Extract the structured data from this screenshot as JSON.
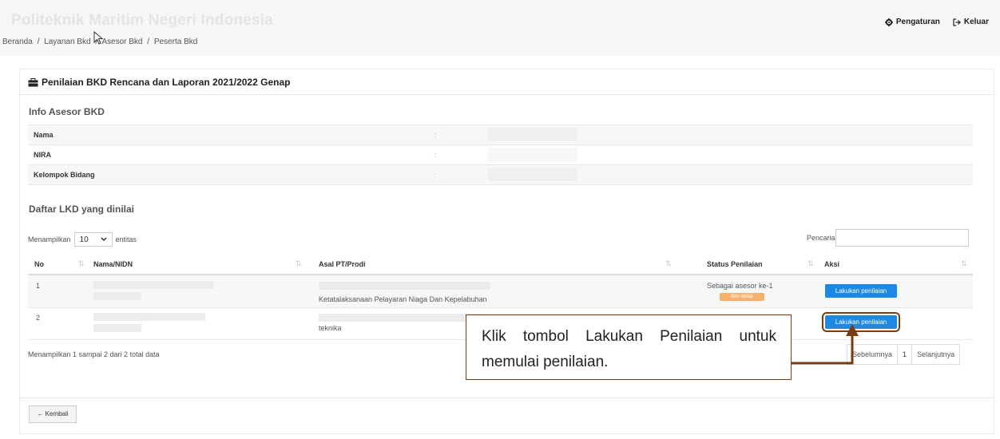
{
  "header": {
    "brand": "Politeknik Maritim Negeri Indonesia",
    "breadcrumb": [
      "Beranda",
      "/",
      "Layanan Bkd",
      "/",
      "Asesor Bkd",
      "/",
      "Peserta Bkd"
    ],
    "settings_label": "Pengaturan",
    "logout_label": "Keluar"
  },
  "card": {
    "title": "Penilaian BKD Rencana dan Laporan 2021/2022 Genap",
    "info_title": "Info Asesor BKD",
    "info_rows": [
      {
        "label": "Nama",
        "colon": ":"
      },
      {
        "label": "NIRA",
        "colon": ":"
      },
      {
        "label": "Kelompok Bidang",
        "colon": ":"
      }
    ],
    "list_title": "Daftar LKD yang dinilai",
    "show_prefix": "Menampilkan",
    "show_value": "10",
    "show_suffix": "entitas",
    "search_label": "Pencarian:",
    "columns": [
      "No",
      "Nama/NIDN",
      "Asal PT/Prodi",
      "Status Penilaian",
      "Aksi"
    ],
    "rows": [
      {
        "no": "1",
        "prodi": "Ketatalaksanaan Pelayaran Niaga Dan Kepelabuhan",
        "status": "Sebagai asesor ke-1",
        "badge": "Blm dinilai",
        "action": "Lakukan penilaian"
      },
      {
        "no": "2",
        "prodi": "teknika",
        "status": "",
        "badge": "",
        "action": "Lakukan penilaian"
      }
    ],
    "summary": "Menampilkan 1 sampai 2 dari 2 total data",
    "pager": {
      "prev": "Sebelumnya",
      "current": "1",
      "next": "Selanjutnya"
    },
    "back_label": "← Kembali"
  },
  "callout": {
    "text": "Klik tombol Lakukan Penilaian untuk memulai penilaian."
  },
  "colors": {
    "accent_blue": "#1e88e5",
    "callout_border": "#7a3a12",
    "badge_orange": "#f6b26b"
  },
  "icons": [
    "gear-icon",
    "logout-icon",
    "briefcase-icon",
    "mouse-cursor-icon",
    "sort-icon",
    "chevron-down-icon"
  ]
}
